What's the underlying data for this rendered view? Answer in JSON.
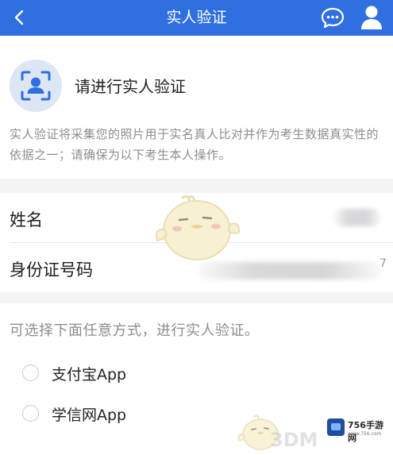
{
  "header": {
    "title": "实人验证",
    "background_color": "#2f6fe0",
    "back_icon": "chevron-left-icon",
    "chat_icon": "chat-bubble-icon",
    "profile_icon": "user-icon"
  },
  "verify": {
    "title": "请进行实人验证",
    "description": "实人验证将采集您的照片用于实名真人比对并作为考生数据真实性的依据之一；请确保为以下考生本人操作。",
    "icon": "face-scan-icon"
  },
  "form": {
    "name_label": "姓名",
    "id_label": "身份证号码",
    "id_tail": "7"
  },
  "options": {
    "prompt": "可选择下面任意方式，进行实人验证。",
    "items": [
      {
        "label": "支付宝App",
        "selected": false
      },
      {
        "label": "学信网App",
        "selected": false
      }
    ]
  },
  "watermark": {
    "text": "3DM",
    "site_name": "756手游网",
    "site_url": "www.756.com"
  }
}
